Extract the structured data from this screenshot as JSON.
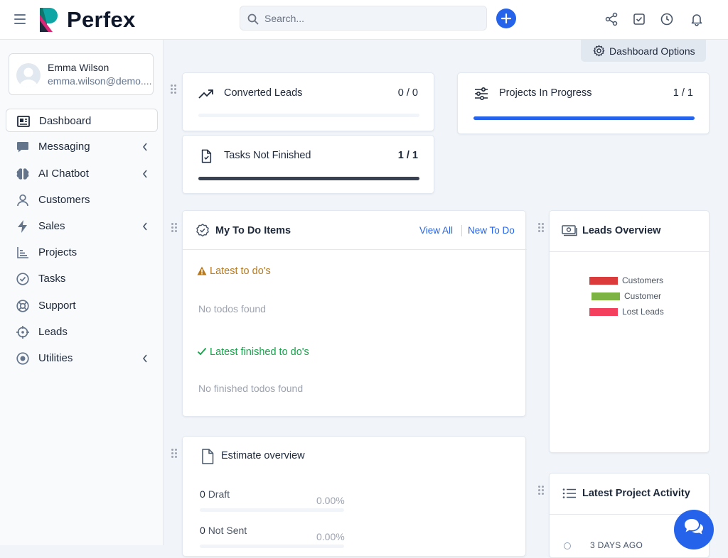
{
  "app": {
    "name": "Perfex"
  },
  "colors": {
    "accent": "#2563eb",
    "warning": "#b7791f",
    "success": "#16a34a",
    "dark_bar": "#374151"
  },
  "search": {
    "placeholder": "Search..."
  },
  "user": {
    "name": "Emma Wilson",
    "email": "emma.wilson@demo...."
  },
  "sidebar": {
    "items": [
      {
        "label": "Dashboard",
        "icon": "dashboard-icon",
        "active": true,
        "submenu": false
      },
      {
        "label": "Messaging",
        "icon": "chat-bubble-icon",
        "submenu": true
      },
      {
        "label": "AI Chatbot",
        "icon": "brain-icon",
        "submenu": true
      },
      {
        "label": "Customers",
        "icon": "user-icon",
        "submenu": false
      },
      {
        "label": "Sales",
        "icon": "bolt-icon",
        "submenu": true
      },
      {
        "label": "Projects",
        "icon": "bar-chart-icon",
        "submenu": false
      },
      {
        "label": "Tasks",
        "icon": "check-circle-icon",
        "submenu": false
      },
      {
        "label": "Support",
        "icon": "lifebuoy-icon",
        "submenu": false
      },
      {
        "label": "Leads",
        "icon": "crosshair-icon",
        "submenu": false
      },
      {
        "label": "Utilities",
        "icon": "record-icon",
        "submenu": true
      }
    ]
  },
  "dashboard_options": {
    "label": "Dashboard Options"
  },
  "stats": {
    "converted_leads": {
      "title": "Converted Leads",
      "value": "0 / 0",
      "progress": 0
    },
    "projects_in_progress": {
      "title": "Projects In Progress",
      "value": "1 / 1",
      "progress": 1
    },
    "tasks_not_finished": {
      "title": "Tasks Not Finished",
      "value": "1 / 1",
      "progress": 1
    }
  },
  "todo": {
    "title": "My To Do Items",
    "view_all": "View All",
    "new_todo": "New To Do",
    "latest_heading": "Latest to do's",
    "latest_empty": "No todos found",
    "finished_heading": "Latest finished to do's",
    "finished_empty": "No finished todos found"
  },
  "leads_overview": {
    "title": "Leads Overview",
    "legend": [
      {
        "label": "Customers",
        "color": "#dc3b3b"
      },
      {
        "label": "Customer",
        "color": "#7cb342"
      },
      {
        "label": "Lost Leads",
        "color": "#f43f5e"
      }
    ]
  },
  "estimates": {
    "title": "Estimate overview",
    "rows": [
      {
        "count": "0",
        "label": "Draft",
        "percent": "0.00%"
      },
      {
        "count": "0",
        "label": "Not Sent",
        "percent": "0.00%"
      }
    ]
  },
  "project_activity": {
    "title": "Latest Project Activity",
    "first_time": "3 DAYS AGO"
  }
}
